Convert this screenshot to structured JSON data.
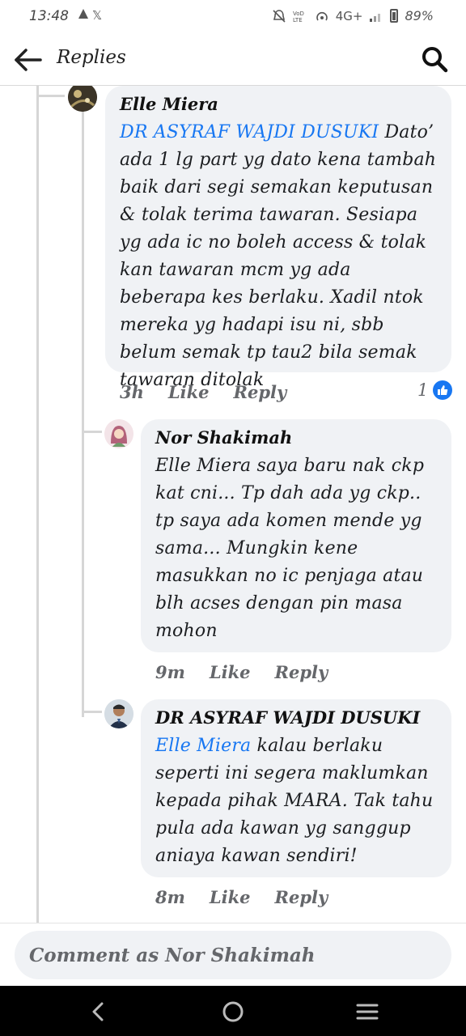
{
  "status_bar": {
    "time": "13:48",
    "network": "4G+",
    "battery": "89%"
  },
  "header": {
    "title": "Replies"
  },
  "comments": [
    {
      "author": "Elle Miera",
      "mention": "DR ASYRAF WAJDI DUSUKI",
      "text": " Dato’ ada 1 lg part yg dato kena tambah baik dari segi semakan keputusan & tolak terima tawaran. Sesiapa yg ada ic no boleh access & tolak kan tawaran mcm yg ada beberapa kes berlaku. Xadil ntok mereka yg hadapi isu ni, sbb belum semak tp tau2 bila semak tawaran ditolak",
      "time": "3h",
      "like_label": "Like",
      "reply_label": "Reply",
      "reaction_count": "1"
    },
    {
      "author": "Nor Shakimah",
      "text": "Elle Miera saya baru nak ckp kat cni... Tp dah ada yg ckp.. tp saya ada komen mende yg sama... Mungkin kene masukkan no ic penjaga atau blh acses dengan pin masa mohon",
      "time": "9m",
      "like_label": "Like",
      "reply_label": "Reply"
    },
    {
      "author": "DR ASYRAF WAJDI DUSUKI",
      "mention": "Elle Miera",
      "text": " kalau berlaku seperti ini segera maklumkan kepada pihak MARA. Tak tahu pula ada kawan yg sanggup aniaya kawan sendiri!",
      "time": "8m",
      "like_label": "Like",
      "reply_label": "Reply"
    }
  ],
  "composer": {
    "placeholder": "Comment as Nor Shakimah"
  }
}
